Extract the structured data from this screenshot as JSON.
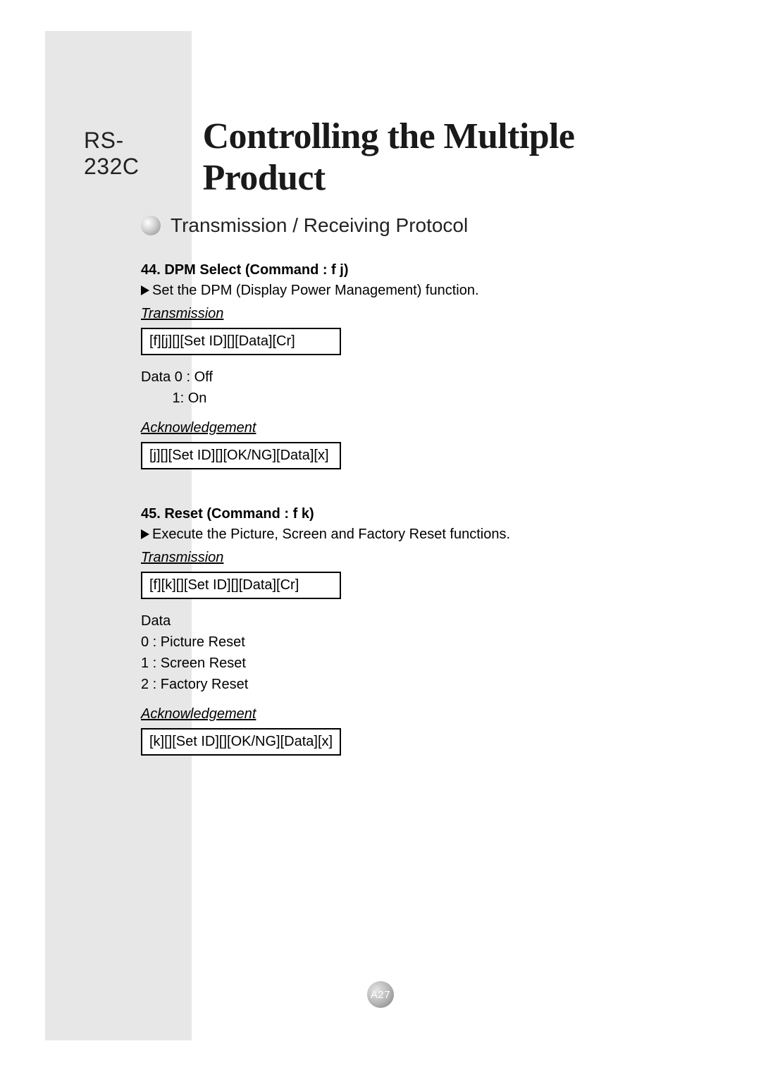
{
  "header": {
    "prefix": "RS-232C",
    "title": "Controlling the Multiple Product"
  },
  "section_title": "Transmission / Receiving Protocol",
  "commands": [
    {
      "title": "44. DPM Select (Command : f j)",
      "desc": "Set the DPM (Display Power Management) function.",
      "tx_label": "Transmission",
      "tx_code": "[f][j][][Set ID][][Data][Cr]",
      "data_text": "Data 0 : Off\n        1: On",
      "ack_label": "Acknowledgement",
      "ack_code": "[j][][Set ID][][OK/NG][Data][x]"
    },
    {
      "title": "45. Reset (Command : f k)",
      "desc": "Execute the Picture, Screen and Factory Reset functions.",
      "tx_label": "Transmission",
      "tx_code": "[f][k][][Set ID][][Data][Cr]",
      "data_text": "Data\n0 : Picture Reset\n1 : Screen Reset\n2 : Factory Reset",
      "ack_label": "Acknowledgement",
      "ack_code": "[k][][Set ID][][OK/NG][Data][x]"
    }
  ],
  "page_number": "A27"
}
